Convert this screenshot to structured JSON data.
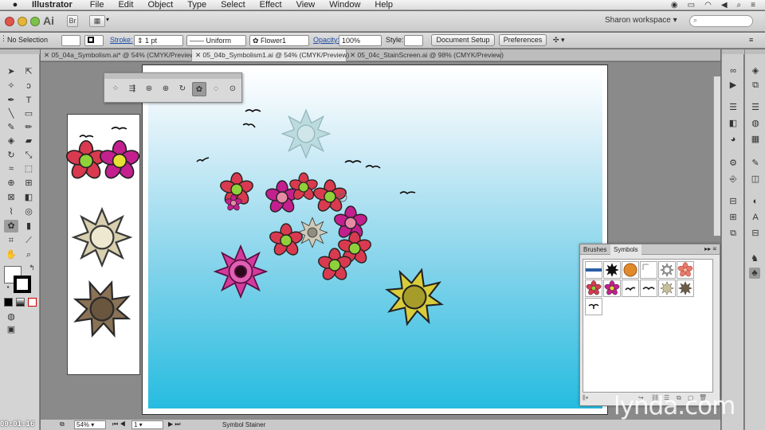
{
  "menubar": {
    "apple": "",
    "app_name": "Illustrator",
    "menus": [
      "File",
      "Edit",
      "Object",
      "Type",
      "Select",
      "Effect",
      "View",
      "Window",
      "Help"
    ]
  },
  "appbar": {
    "logo": "Ai",
    "br_label": "Br",
    "workspace": "Sharon workspace",
    "workspace_arrow": "▾"
  },
  "control_bar": {
    "selection": "No Selection",
    "stroke_label": "Stroke:",
    "stroke_value": "1 pt",
    "stroke_style": "Uniform",
    "symbol_name": "Flower1",
    "opacity_label": "Opacity:",
    "opacity_value": "100%",
    "style_label": "Style:",
    "doc_setup": "Document Setup",
    "preferences": "Preferences"
  },
  "tabs": [
    {
      "label": "05_04a_Symbolism.ai* @ 54% (CMYK/Preview)",
      "active": false
    },
    {
      "label": "05_04b_Symbolism1.ai @ 54% (CMYK/Preview)",
      "active": true
    },
    {
      "label": "05_04c_StainScreen.ai @ 98% (CMYK/Preview)",
      "active": false
    }
  ],
  "symbols_panel": {
    "tabs": [
      "Brushes",
      "Symbols"
    ]
  },
  "statusbar": {
    "zoom": "54%",
    "artboard": "1",
    "tool_name": "Symbol Stainer"
  },
  "overlay": {
    "timecode": "00:01:16",
    "watermark": "lynda.com"
  },
  "colors": {
    "flower_red": "#d93a4f",
    "flower_magenta": "#c41f8f",
    "flower_pink": "#e68aa6",
    "center_green": "#8fd13a",
    "center_yellow": "#e6e034",
    "sky_bottom": "#26bce0"
  }
}
